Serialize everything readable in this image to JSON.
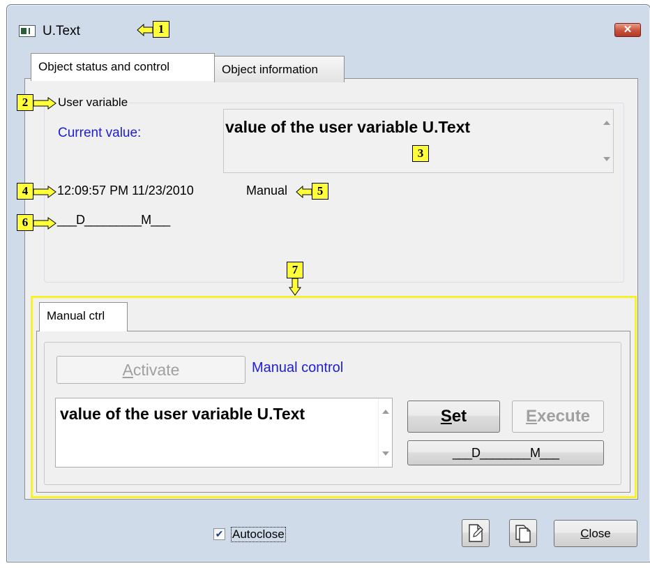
{
  "window": {
    "title": "U.Text",
    "close_glyph": "✕"
  },
  "tabs": [
    {
      "label": "Object status and control"
    },
    {
      "label": "Object information"
    }
  ],
  "status": {
    "group_label": "User variable",
    "current_value_label": "Current value:",
    "current_value": "value of the user variable U.Text",
    "timestamp": "12:09:57 PM 11/23/2010",
    "mode": "Manual",
    "flags": "___D_________M___"
  },
  "manual": {
    "tab_label": "Manual ctrl",
    "activate_label": "Activate",
    "activate_underline": "A",
    "activate_rest": "ctivate",
    "manual_control_label": "Manual control",
    "edit_value": "value of the user variable U.Text",
    "set_underline": "S",
    "set_rest": "et",
    "execute_underline": "E",
    "execute_rest": "xecute",
    "flags_button": "___D________M___"
  },
  "footer": {
    "autoclose_label": "Autoclose",
    "autoclose_checked": true,
    "close_underline": "C",
    "close_rest": "lose"
  },
  "callouts": [
    "1",
    "2",
    "3",
    "4",
    "5",
    "6",
    "7"
  ],
  "colors": {
    "callout_fill": "#ffff3b",
    "highlight": "#f6f32a",
    "label_blue": "#1d1dd6"
  }
}
